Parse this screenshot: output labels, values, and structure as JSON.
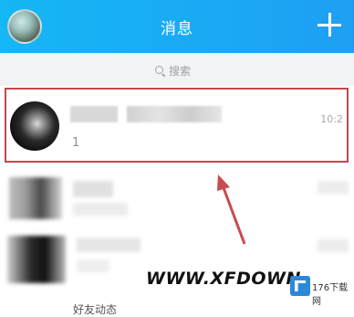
{
  "header": {
    "title": "消息"
  },
  "search": {
    "label": "搜索"
  },
  "conversation": {
    "preview": "1",
    "time": "10:2"
  },
  "watermark": {
    "text": "WWW.XFDOWN",
    "logo_text": "176下载网"
  },
  "bottom": {
    "text": "好友动态"
  }
}
